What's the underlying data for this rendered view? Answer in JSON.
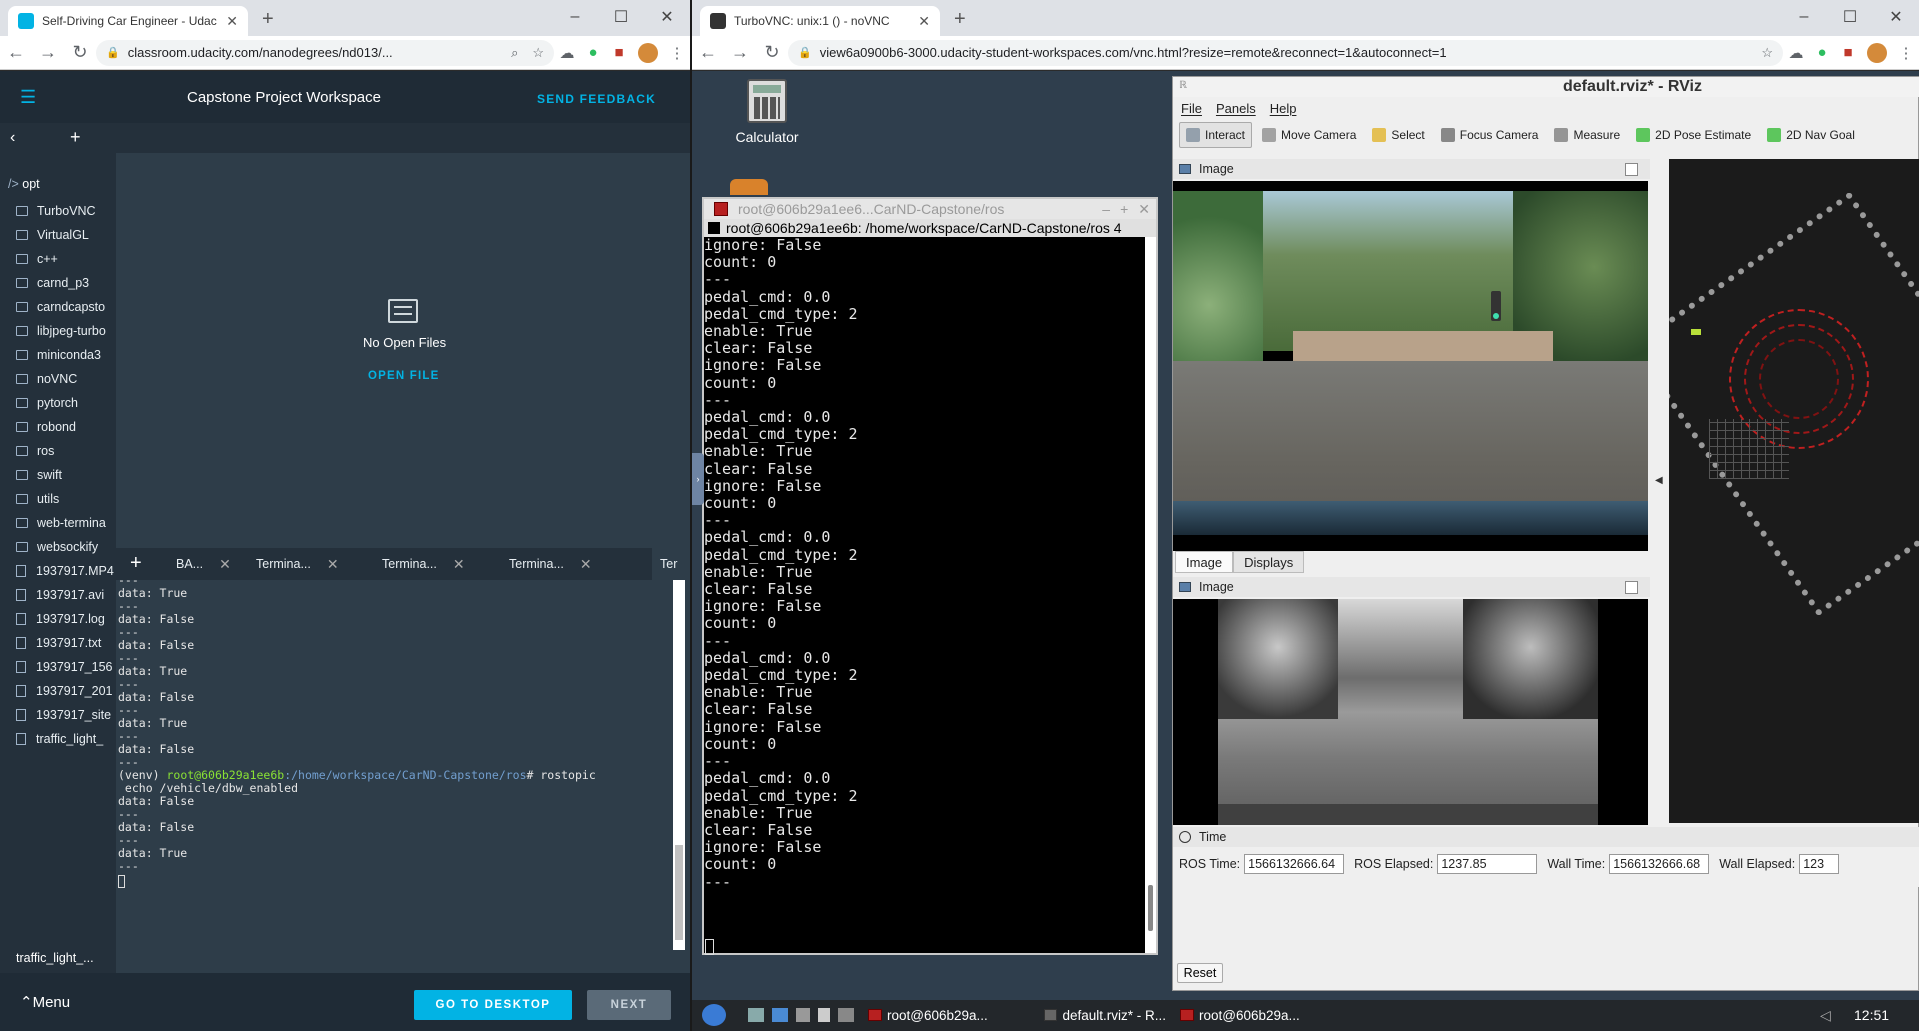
{
  "left_browser": {
    "tab_title": "Self-Driving Car Engineer - Udac",
    "url": "classroom.udacity.com/nanodegrees/nd013/...",
    "workspace_title": "Capstone Project Workspace",
    "send_feedback": "SEND FEEDBACK",
    "breadcrumb_prefix": "/>",
    "breadcrumb_folder": "opt",
    "tree": [
      {
        "type": "folder",
        "name": "TurboVNC"
      },
      {
        "type": "folder",
        "name": "VirtualGL"
      },
      {
        "type": "folder",
        "name": "c++"
      },
      {
        "type": "folder",
        "name": "carnd_p3"
      },
      {
        "type": "folder",
        "name": "carndcapsto"
      },
      {
        "type": "folder",
        "name": "libjpeg-turbo"
      },
      {
        "type": "folder",
        "name": "miniconda3"
      },
      {
        "type": "folder",
        "name": "noVNC"
      },
      {
        "type": "folder",
        "name": "pytorch"
      },
      {
        "type": "folder",
        "name": "robond"
      },
      {
        "type": "folder",
        "name": "ros"
      },
      {
        "type": "folder",
        "name": "swift"
      },
      {
        "type": "folder",
        "name": "utils"
      },
      {
        "type": "folder",
        "name": "web-termina"
      },
      {
        "type": "folder",
        "name": "websockify"
      },
      {
        "type": "file",
        "name": "1937917.MP4"
      },
      {
        "type": "file",
        "name": "1937917.avi"
      },
      {
        "type": "file",
        "name": "1937917.log"
      },
      {
        "type": "file",
        "name": "1937917.txt"
      },
      {
        "type": "file",
        "name": "1937917_156"
      },
      {
        "type": "file",
        "name": "1937917_201"
      },
      {
        "type": "file",
        "name": "1937917_site"
      },
      {
        "type": "file",
        "name": "traffic_light_"
      }
    ],
    "upload_name": "traffic_light_...",
    "upload_progress": 0.75,
    "no_open_files": "No Open Files",
    "open_file": "OPEN FILE",
    "terminal_tabs": [
      "BA...",
      "Termina...",
      "Termina...",
      "Termina...",
      "Ter"
    ],
    "terminal_prompt_env": "(venv)",
    "terminal_prompt_user": "root@606b29a1ee6b",
    "terminal_prompt_path": ":/home/workspace/CarND-Capstone/ros",
    "terminal_prompt_cmd": "# rostopic",
    "terminal_prompt_cmd2": " echo /vehicle/dbw_enabled",
    "terminal_lines_before": [
      "---",
      "data: True",
      "---",
      "data: False",
      "---",
      "data: False",
      "---",
      "data: True",
      "---",
      "data: False",
      "---",
      "data: True",
      "---",
      "data: False",
      "---"
    ],
    "terminal_lines_after": [
      "data: False",
      "---",
      "data: False",
      "---",
      "data: True",
      "---"
    ],
    "menu": "Menu",
    "go_to_desktop": "GO TO DESKTOP",
    "next": "NEXT"
  },
  "right_browser": {
    "tab_title": "TurboVNC: unix:1 () - noVNC",
    "url": "view6a0900b6-3000.udacity-student-workspaces.com/vnc.html?resize=remote&reconnect=1&autoconnect=1",
    "desktop_icon_label": "Calculator",
    "xterm_title": "root@606b29a1ee6...CarND-Capstone/ros",
    "xterm_subtitle": "root@606b29a1ee6b: /home/workspace/CarND-Capstone/ros 4",
    "xterm_lines": [
      "ignore: False",
      "count: 0",
      "---",
      "pedal_cmd: 0.0",
      "pedal_cmd_type: 2",
      "enable: True",
      "clear: False",
      "ignore: False",
      "count: 0",
      "---",
      "pedal_cmd: 0.0",
      "pedal_cmd_type: 2",
      "enable: True",
      "clear: False",
      "ignore: False",
      "count: 0",
      "---",
      "pedal_cmd: 0.0",
      "pedal_cmd_type: 2",
      "enable: True",
      "clear: False",
      "ignore: False",
      "count: 0",
      "---",
      "pedal_cmd: 0.0",
      "pedal_cmd_type: 2",
      "enable: True",
      "clear: False",
      "ignore: False",
      "count: 0",
      "---",
      "pedal_cmd: 0.0",
      "pedal_cmd_type: 2",
      "enable: True",
      "clear: False",
      "ignore: False",
      "count: 0",
      "---"
    ],
    "rviz": {
      "title": "default.rviz* - RViz",
      "menus": [
        "File",
        "Panels",
        "Help"
      ],
      "tools": [
        "Interact",
        "Move Camera",
        "Select",
        "Focus Camera",
        "Measure",
        "2D Pose Estimate",
        "2D Nav Goal"
      ],
      "image_panel_title": "Image",
      "bottom_tabs": [
        "Image",
        "Displays"
      ],
      "time_panel_title": "Time",
      "ros_time_label": "ROS Time:",
      "ros_time_value": "1566132666.64",
      "ros_elapsed_label": "ROS Elapsed:",
      "ros_elapsed_value": "1237.85",
      "wall_time_label": "Wall Time:",
      "wall_time_value": "1566132666.68",
      "wall_elapsed_label": "Wall Elapsed:",
      "wall_elapsed_value": "123",
      "reset": "Reset"
    },
    "taskbar": {
      "items": [
        "root@606b29a...",
        "default.rviz* - R...",
        "root@606b29a..."
      ],
      "clock": "12:51"
    }
  }
}
